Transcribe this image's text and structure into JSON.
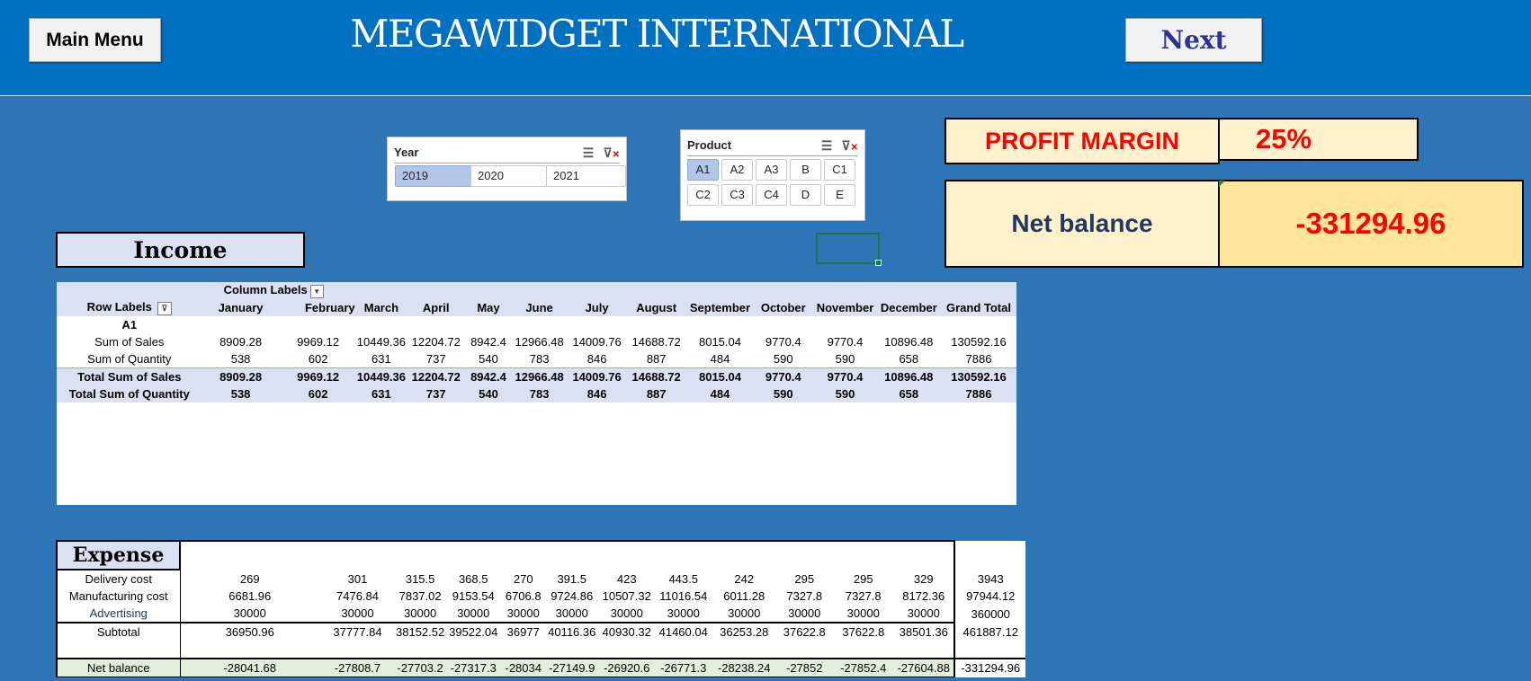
{
  "header": {
    "title": "MEGAWIDGET INTERNATIONAL",
    "main_menu_label": "Main Menu",
    "next_label": "Next"
  },
  "year_slicer": {
    "title": "Year",
    "items": [
      "2019",
      "2020",
      "2021"
    ],
    "selected": "2019"
  },
  "product_slicer": {
    "title": "Product",
    "items": [
      "A1",
      "A2",
      "A3",
      "B",
      "C1",
      "C2",
      "C3",
      "C4",
      "D",
      "E"
    ],
    "selected": "A1"
  },
  "kpi": {
    "profit_margin_label": "PROFIT MARGIN",
    "profit_margin_value": "25%",
    "net_balance_label": "Net balance",
    "net_balance_value": "-331294.96"
  },
  "income": {
    "title": "Income",
    "column_labels": "Column Labels",
    "row_labels": "Row Labels",
    "months": [
      "January",
      "February",
      "March",
      "April",
      "May",
      "June",
      "July",
      "August",
      "September",
      "October",
      "November",
      "December",
      "Grand Total"
    ],
    "group": "A1",
    "rows": [
      {
        "label": "Sum of Sales",
        "values": [
          "8909.28",
          "9969.12",
          "10449.36",
          "12204.72",
          "8942.4",
          "12966.48",
          "14009.76",
          "14688.72",
          "8015.04",
          "9770.4",
          "9770.4",
          "10896.48",
          "130592.16"
        ]
      },
      {
        "label": "Sum of Quantity",
        "values": [
          "538",
          "602",
          "631",
          "737",
          "540",
          "783",
          "846",
          "887",
          "484",
          "590",
          "590",
          "658",
          "7886"
        ]
      },
      {
        "label": "Total Sum of Sales",
        "values": [
          "8909.28",
          "9969.12",
          "10449.36",
          "12204.72",
          "8942.4",
          "12966.48",
          "14009.76",
          "14688.72",
          "8015.04",
          "9770.4",
          "9770.4",
          "10896.48",
          "130592.16"
        ]
      },
      {
        "label": "Total Sum of Quantity",
        "values": [
          "538",
          "602",
          "631",
          "737",
          "540",
          "783",
          "846",
          "887",
          "484",
          "590",
          "590",
          "658",
          "7886"
        ]
      }
    ]
  },
  "expense": {
    "title": "Expense",
    "rows": [
      {
        "label": "Delivery cost",
        "values": [
          "269",
          "301",
          "315.5",
          "368.5",
          "270",
          "391.5",
          "423",
          "443.5",
          "242",
          "295",
          "295",
          "329",
          "3943"
        ]
      },
      {
        "label": "Manufacturing cost",
        "values": [
          "6681.96",
          "7476.84",
          "7837.02",
          "9153.54",
          "6706.8",
          "9724.86",
          "10507.32",
          "11016.54",
          "6011.28",
          "7327.8",
          "7327.8",
          "8172.36",
          "97944.12"
        ]
      },
      {
        "label": "Advertising",
        "values": [
          "30000",
          "30000",
          "30000",
          "30000",
          "30000",
          "30000",
          "30000",
          "30000",
          "30000",
          "30000",
          "30000",
          "30000",
          "360000"
        ]
      },
      {
        "label": "Subtotal",
        "values": [
          "36950.96",
          "37777.84",
          "38152.52",
          "39522.04",
          "36977",
          "40116.36",
          "40930.32",
          "41460.04",
          "36253.28",
          "37622.8",
          "37622.8",
          "38501.36",
          "461887.12"
        ]
      }
    ],
    "net_balance": {
      "label": "Net balance",
      "values": [
        "-28041.68",
        "-27808.7",
        "-27703.2",
        "-27317.3",
        "-28034",
        "-27149.9",
        "-26920.6",
        "-26771.3",
        "-28238.24",
        "-27852",
        "-27852.4",
        "-27604.88",
        "-331294.96"
      ]
    }
  }
}
